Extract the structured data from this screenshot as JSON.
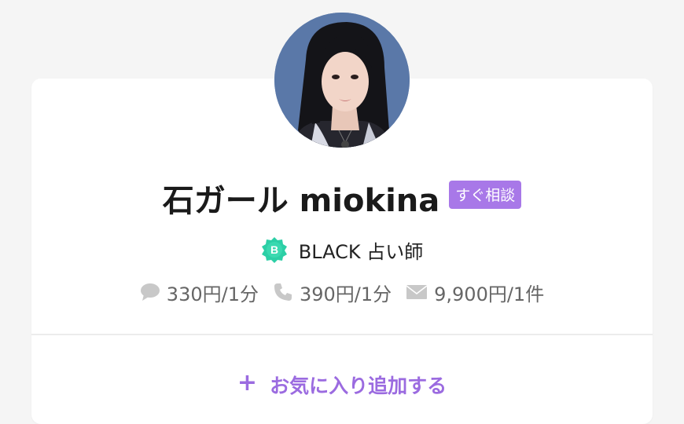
{
  "profile": {
    "name": "石ガール miokina",
    "status_badge": "すぐ相談",
    "rank_letter": "B",
    "rank_text": "BLACK  占い師"
  },
  "prices": {
    "chat": "330円/1分",
    "phone": "390円/1分",
    "mail": "9,900円/1件"
  },
  "actions": {
    "favorite_icon": "+",
    "favorite_label": "お気に入り追加する"
  },
  "icons": {
    "chat": "chat-bubble-icon",
    "phone": "phone-icon",
    "mail": "mail-icon",
    "rank": "rank-badge-icon"
  },
  "colors": {
    "accent": "#a878e8",
    "accent_text": "#9b6be0",
    "rank_badge": "#2ccfa6",
    "muted_icon": "#c8c8c8"
  }
}
